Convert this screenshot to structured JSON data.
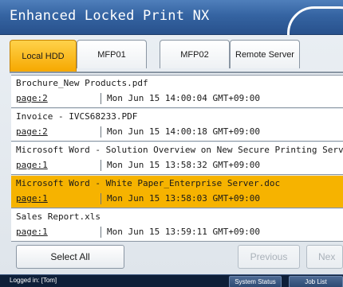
{
  "header": {
    "title": "Enhanced Locked Print NX"
  },
  "tabs": [
    {
      "label": "Local HDD",
      "active": true
    },
    {
      "label": "MFP01",
      "active": false
    },
    {
      "label": "MFP02",
      "active": false
    },
    {
      "label": "Remote Server",
      "active": false
    }
  ],
  "files": [
    {
      "name": "Brochure_New Products.pdf",
      "page": "page:2",
      "date": "Mon Jun 15 14:00:04 GMT+09:00",
      "selected": false
    },
    {
      "name": "Invoice - IVCS68233.PDF",
      "page": "page:2",
      "date": "Mon Jun 15 14:00:18 GMT+09:00",
      "selected": false
    },
    {
      "name": "Microsoft Word - Solution Overview on New Secure Printing Service.doc",
      "page": "page:1",
      "date": "Mon Jun 15 13:58:32 GMT+09:00",
      "selected": false
    },
    {
      "name": "Microsoft Word - White Paper_Enterprise Server.doc",
      "page": "page:1",
      "date": "Mon Jun 15 13:58:03 GMT+09:00",
      "selected": true
    },
    {
      "name": "Sales Report.xls",
      "page": "page:1",
      "date": "Mon Jun 15 13:59:11 GMT+09:00",
      "selected": false
    }
  ],
  "actions": {
    "select_all": "Select All",
    "previous": "Previous",
    "next": "Nex"
  },
  "status": {
    "logged_in": "Logged in: [Tom]",
    "system_status": "System Status",
    "job_list": "Job List"
  },
  "colors": {
    "selected_row": "#f6b300",
    "active_tab": "#f6a800",
    "title_bar": "#3564a2"
  }
}
